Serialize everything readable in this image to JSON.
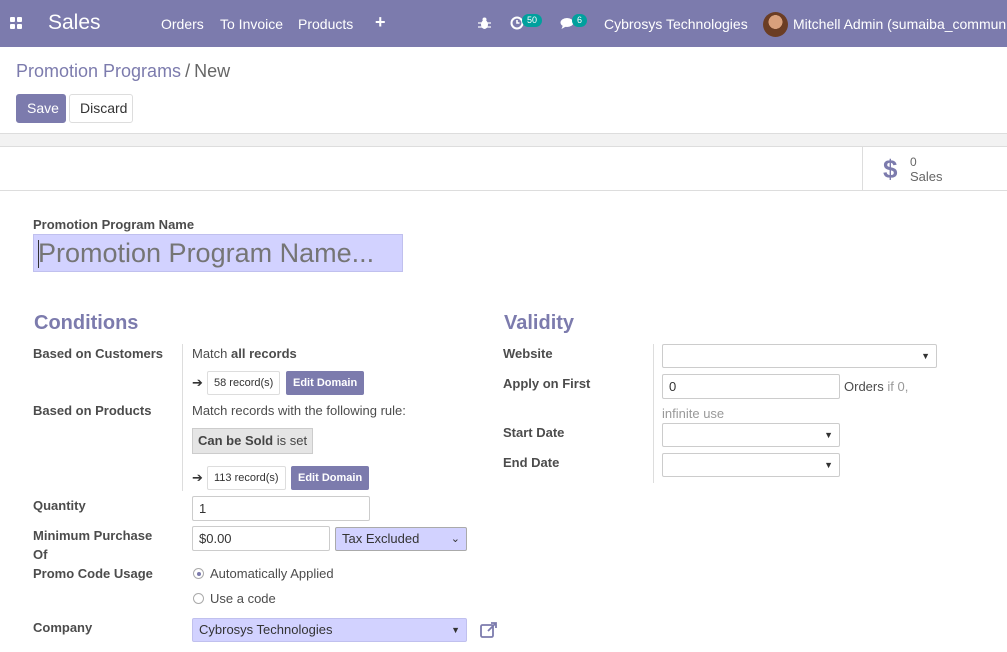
{
  "navbar": {
    "app_name": "Sales",
    "menu": [
      "Orders",
      "To Invoice",
      "Products"
    ],
    "activity_count": "50",
    "message_count": "6",
    "company": "Cybrosys Technologies",
    "user": "Mitchell Admin (sumaiba_community)"
  },
  "breadcrumb": {
    "parent": "Promotion Programs",
    "separator": "/",
    "current": "New"
  },
  "buttons": {
    "save": "Save",
    "discard": "Discard"
  },
  "stat_button": {
    "icon": "dollar-icon",
    "value": "0",
    "label": "Sales"
  },
  "name_field": {
    "label": "Promotion Program Name",
    "placeholder": "Promotion Program Name..."
  },
  "conditions": {
    "title": "Conditions",
    "based_on_customers": {
      "label": "Based on Customers",
      "match_prefix": "Match",
      "match_bold": "all records",
      "records": "58 record(s)",
      "edit_domain": "Edit Domain"
    },
    "based_on_products": {
      "label": "Based on Products",
      "rule_text": "Match records with the following rule:",
      "rule_field": "Can be Sold",
      "rule_op": "is set",
      "records": "113 record(s)",
      "edit_domain": "Edit Domain"
    },
    "quantity": {
      "label": "Quantity",
      "value": "1"
    },
    "minimum_purchase": {
      "label_line1": "Minimum Purchase",
      "label_line2": "Of",
      "value": "$0.00",
      "tax": "Tax Excluded"
    },
    "promo_code_usage": {
      "label": "Promo Code Usage",
      "options": [
        "Automatically Applied",
        "Use a code"
      ],
      "selected": "Automatically Applied"
    },
    "company": {
      "label": "Company",
      "value": "Cybrosys Technologies"
    }
  },
  "validity": {
    "title": "Validity",
    "website": {
      "label": "Website",
      "value": ""
    },
    "apply_on_first": {
      "label": "Apply on First",
      "value": "0",
      "suffix": "Orders",
      "hint": "if 0,",
      "hint2": "infinite use"
    },
    "start_date": {
      "label": "Start Date",
      "value": ""
    },
    "end_date": {
      "label": "End Date",
      "value": ""
    }
  },
  "colors": {
    "brand": "#7c7bad",
    "required_field": "#d2d2ff"
  }
}
